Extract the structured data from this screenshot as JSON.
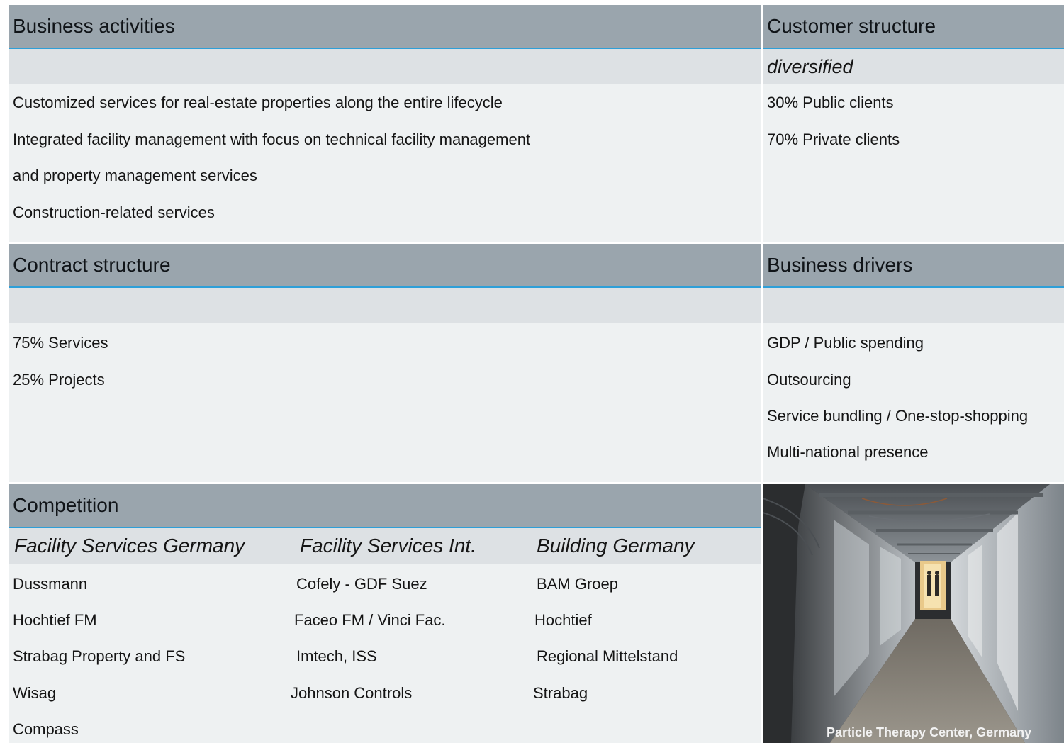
{
  "business_activities": {
    "title": "Business activities",
    "lines": [
      "Customized services for real-estate properties along the entire lifecycle",
      "Integrated facility management with focus on technical facility management",
      "and property management services",
      "Construction-related services"
    ]
  },
  "customer_structure": {
    "title": "Customer structure",
    "subtitle": "diversified",
    "lines": [
      "30% Public clients",
      "70% Private clients"
    ]
  },
  "contract_structure": {
    "title": "Contract structure",
    "lines": [
      "75% Services",
      "25% Projects"
    ]
  },
  "business_drivers": {
    "title": "Business drivers",
    "lines": [
      "GDP / Public spending",
      "Outsourcing",
      "Service bundling / One-stop-shopping",
      "Multi-national presence"
    ]
  },
  "competition": {
    "title": "Competition",
    "columns": [
      {
        "heading": "Facility Services Germany",
        "items": [
          "Dussmann",
          "Hochtief FM",
          "Strabag Property and FS",
          "Wisag",
          "Compass"
        ]
      },
      {
        "heading": "Facility Services Int.",
        "items": [
          "Cofely - GDF Suez",
          "Faceo FM / Vinci Fac.",
          "Imtech, ISS",
          "Johnson Controls"
        ]
      },
      {
        "heading": "Building Germany",
        "items": [
          "BAM Groep",
          "Hochtief",
          "Regional Mittelstand",
          "Strabag"
        ]
      }
    ]
  },
  "photo": {
    "caption": "Particle Therapy Center, Germany"
  },
  "colors": {
    "header_bg": "#9aa5ad",
    "header_rule": "#2e9fd8",
    "subheader_bg": "#dde1e4",
    "panel_bg": "#eef1f2"
  }
}
